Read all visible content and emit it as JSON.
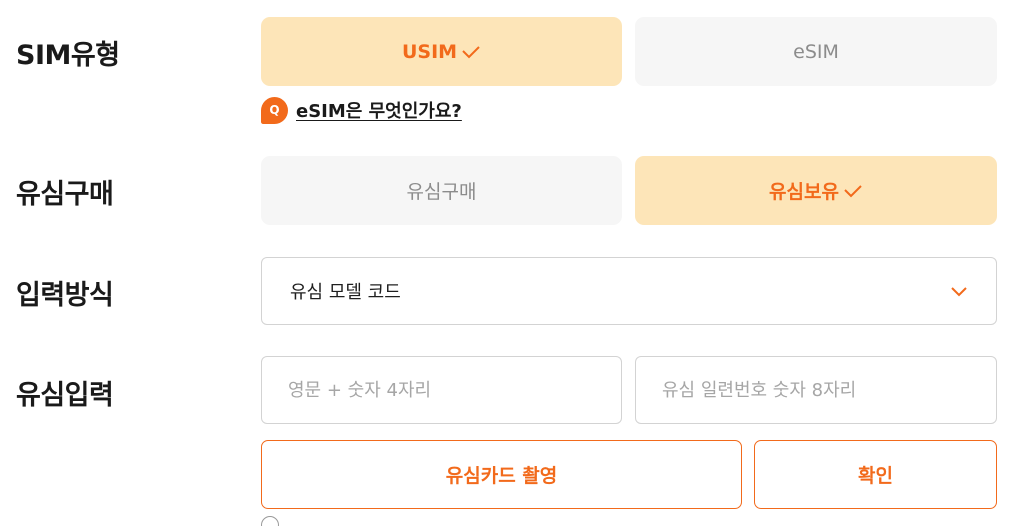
{
  "form": {
    "sim_type": {
      "label": "SIM유형",
      "options": [
        {
          "label": "USIM",
          "selected": true
        },
        {
          "label": "eSIM",
          "selected": false
        }
      ]
    },
    "esim_faq": {
      "badge": "Q",
      "text": "eSIM은 무엇인가요?"
    },
    "sim_purchase": {
      "label": "유심구매",
      "options": [
        {
          "label": "유심구매",
          "selected": false
        },
        {
          "label": "유심보유",
          "selected": true
        }
      ]
    },
    "input_method": {
      "label": "입력방식",
      "selected_value": "유심 모델 코드"
    },
    "sim_input": {
      "label": "유심입력",
      "model_code_placeholder": "영문 + 숫자 4자리",
      "serial_placeholder": "유심 일련번호 숫자 8자리"
    },
    "buttons": {
      "capture_label": "유심카드 촬영",
      "confirm_label": "확인"
    }
  },
  "icons": {
    "check": "check-icon",
    "chevron": "chevron-down-icon",
    "info": "info-icon"
  },
  "colors": {
    "accent": "#f26a1b",
    "selected_bg": "#fde5b8",
    "unselected_bg": "#f6f6f6",
    "border": "#d3d3d3"
  }
}
